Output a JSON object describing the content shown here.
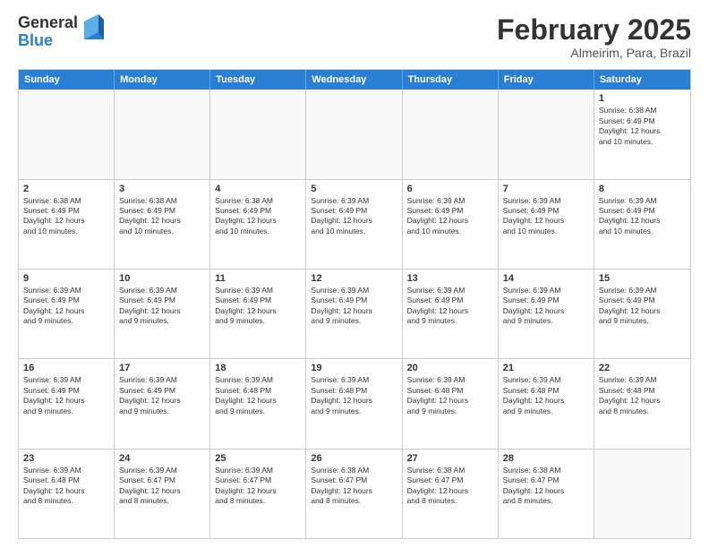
{
  "logo": {
    "general": "General",
    "blue": "Blue"
  },
  "header": {
    "month": "February 2025",
    "location": "Almeirim, Para, Brazil"
  },
  "weekdays": [
    "Sunday",
    "Monday",
    "Tuesday",
    "Wednesday",
    "Thursday",
    "Friday",
    "Saturday"
  ],
  "weeks": [
    [
      {
        "day": "",
        "empty": true
      },
      {
        "day": "",
        "empty": true
      },
      {
        "day": "",
        "empty": true
      },
      {
        "day": "",
        "empty": true
      },
      {
        "day": "",
        "empty": true
      },
      {
        "day": "",
        "empty": true
      },
      {
        "day": "1",
        "info": "Sunrise: 6:38 AM\nSunset: 6:49 PM\nDaylight: 12 hours\nand 10 minutes."
      }
    ],
    [
      {
        "day": "2",
        "info": "Sunrise: 6:38 AM\nSunset: 6:49 PM\nDaylight: 12 hours\nand 10 minutes."
      },
      {
        "day": "3",
        "info": "Sunrise: 6:38 AM\nSunset: 6:49 PM\nDaylight: 12 hours\nand 10 minutes."
      },
      {
        "day": "4",
        "info": "Sunrise: 6:38 AM\nSunset: 6:49 PM\nDaylight: 12 hours\nand 10 minutes."
      },
      {
        "day": "5",
        "info": "Sunrise: 6:39 AM\nSunset: 6:49 PM\nDaylight: 12 hours\nand 10 minutes."
      },
      {
        "day": "6",
        "info": "Sunrise: 6:39 AM\nSunset: 6:49 PM\nDaylight: 12 hours\nand 10 minutes."
      },
      {
        "day": "7",
        "info": "Sunrise: 6:39 AM\nSunset: 6:49 PM\nDaylight: 12 hours\nand 10 minutes."
      },
      {
        "day": "8",
        "info": "Sunrise: 6:39 AM\nSunset: 6:49 PM\nDaylight: 12 hours\nand 10 minutes."
      }
    ],
    [
      {
        "day": "9",
        "info": "Sunrise: 6:39 AM\nSunset: 6:49 PM\nDaylight: 12 hours\nand 9 minutes."
      },
      {
        "day": "10",
        "info": "Sunrise: 6:39 AM\nSunset: 6:49 PM\nDaylight: 12 hours\nand 9 minutes."
      },
      {
        "day": "11",
        "info": "Sunrise: 6:39 AM\nSunset: 6:49 PM\nDaylight: 12 hours\nand 9 minutes."
      },
      {
        "day": "12",
        "info": "Sunrise: 6:39 AM\nSunset: 6:49 PM\nDaylight: 12 hours\nand 9 minutes."
      },
      {
        "day": "13",
        "info": "Sunrise: 6:39 AM\nSunset: 6:49 PM\nDaylight: 12 hours\nand 9 minutes."
      },
      {
        "day": "14",
        "info": "Sunrise: 6:39 AM\nSunset: 6:49 PM\nDaylight: 12 hours\nand 9 minutes."
      },
      {
        "day": "15",
        "info": "Sunrise: 6:39 AM\nSunset: 6:49 PM\nDaylight: 12 hours\nand 9 minutes."
      }
    ],
    [
      {
        "day": "16",
        "info": "Sunrise: 6:39 AM\nSunset: 6:49 PM\nDaylight: 12 hours\nand 9 minutes."
      },
      {
        "day": "17",
        "info": "Sunrise: 6:39 AM\nSunset: 6:49 PM\nDaylight: 12 hours\nand 9 minutes."
      },
      {
        "day": "18",
        "info": "Sunrise: 6:39 AM\nSunset: 6:48 PM\nDaylight: 12 hours\nand 9 minutes."
      },
      {
        "day": "19",
        "info": "Sunrise: 6:39 AM\nSunset: 6:48 PM\nDaylight: 12 hours\nand 9 minutes."
      },
      {
        "day": "20",
        "info": "Sunrise: 6:39 AM\nSunset: 6:48 PM\nDaylight: 12 hours\nand 9 minutes."
      },
      {
        "day": "21",
        "info": "Sunrise: 6:39 AM\nSunset: 6:48 PM\nDaylight: 12 hours\nand 9 minutes."
      },
      {
        "day": "22",
        "info": "Sunrise: 6:39 AM\nSunset: 6:48 PM\nDaylight: 12 hours\nand 8 minutes."
      }
    ],
    [
      {
        "day": "23",
        "info": "Sunrise: 6:39 AM\nSunset: 6:48 PM\nDaylight: 12 hours\nand 8 minutes."
      },
      {
        "day": "24",
        "info": "Sunrise: 6:39 AM\nSunset: 6:47 PM\nDaylight: 12 hours\nand 8 minutes."
      },
      {
        "day": "25",
        "info": "Sunrise: 6:39 AM\nSunset: 6:47 PM\nDaylight: 12 hours\nand 8 minutes."
      },
      {
        "day": "26",
        "info": "Sunrise: 6:38 AM\nSunset: 6:47 PM\nDaylight: 12 hours\nand 8 minutes."
      },
      {
        "day": "27",
        "info": "Sunrise: 6:38 AM\nSunset: 6:47 PM\nDaylight: 12 hours\nand 8 minutes."
      },
      {
        "day": "28",
        "info": "Sunrise: 6:38 AM\nSunset: 6:47 PM\nDaylight: 12 hours\nand 8 minutes."
      },
      {
        "day": "",
        "empty": true
      }
    ]
  ]
}
